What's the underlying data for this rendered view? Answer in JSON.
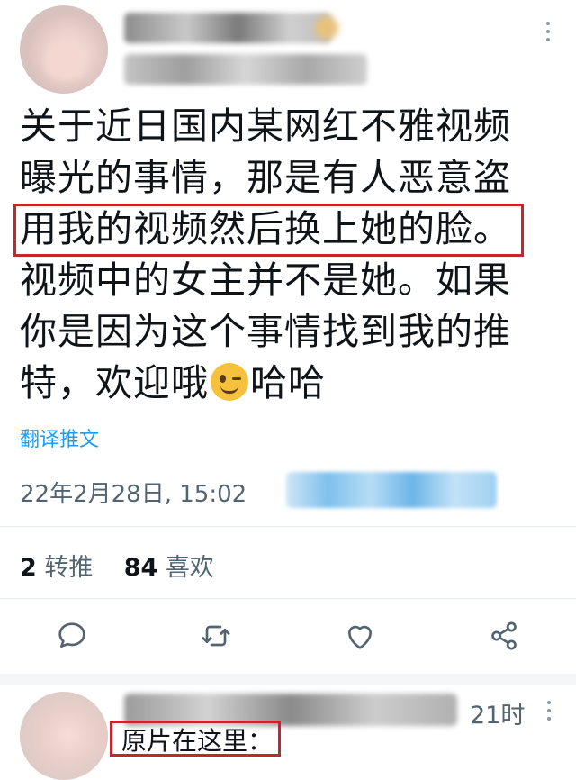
{
  "tweet": {
    "lines": [
      "关于近日国内某网红不雅视频",
      "曝光的事情，那是有人恶意盗",
      "用我的视频然后换上她的脸。",
      "视频中的女主并不是她。如果",
      "你是因为这个事情找到我的推",
      "特，欢迎哦"
    ],
    "line6_after_emoji": "哈哈",
    "emoji": "winking-face-emoji",
    "translate_link": "翻译推文",
    "timestamp": "22年2月28日, 15:02"
  },
  "stats": {
    "retweets_count": "2",
    "retweets_label": "转推",
    "likes_count": "84",
    "likes_label": "喜欢"
  },
  "actions": [
    "reply-icon",
    "retweet-icon",
    "like-icon",
    "share-icon"
  ],
  "reply": {
    "time": "21时",
    "text": "原片在这里："
  },
  "colors": {
    "link": "#1d9bf0",
    "secondary_text": "#536471",
    "highlight_border": "#c1272d"
  }
}
